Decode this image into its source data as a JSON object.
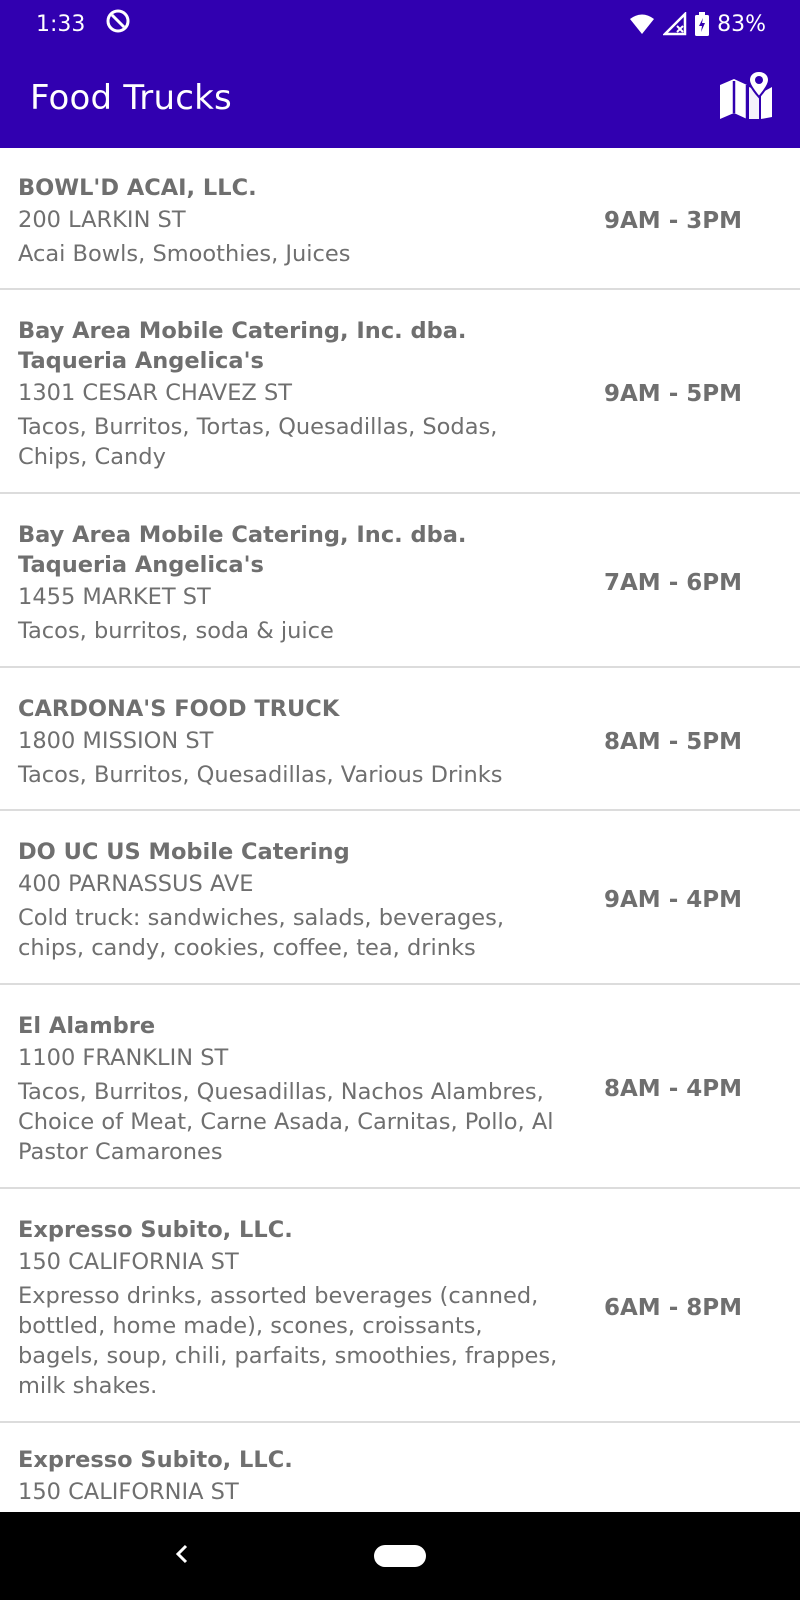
{
  "status_bar": {
    "time": "1:33",
    "battery": "83%",
    "icons": [
      "data-saver-icon",
      "wifi-icon",
      "signal-icon",
      "battery-icon"
    ]
  },
  "app_bar": {
    "title": "Food Trucks",
    "map_icon": "map-icon",
    "color": "#3100b0"
  },
  "trucks": [
    {
      "name": "BOWL'D ACAI, LLC.",
      "address": "200 LARKIN ST",
      "items": "Acai Bowls, Smoothies, Juices",
      "hours": "9AM - 3PM"
    },
    {
      "name": "Bay Area Mobile Catering, Inc. dba. Taqueria Angelica's",
      "address": "1301 CESAR CHAVEZ ST",
      "items": "Tacos, Burritos, Tortas, Quesadillas, Sodas, Chips, Candy",
      "hours": "9AM - 5PM"
    },
    {
      "name": "Bay Area Mobile Catering, Inc. dba. Taqueria Angelica's",
      "address": "1455 MARKET ST",
      "items": "Tacos, burritos, soda & juice",
      "hours": "7AM - 6PM"
    },
    {
      "name": "CARDONA'S FOOD TRUCK",
      "address": "1800 MISSION ST",
      "items": "Tacos, Burritos, Quesadillas, Various Drinks",
      "hours": "8AM - 5PM"
    },
    {
      "name": "DO UC US Mobile Catering",
      "address": "400 PARNASSUS AVE",
      "items": "Cold truck: sandwiches, salads, beverages, chips, candy, cookies, coffee, tea, drinks",
      "hours": "9AM - 4PM"
    },
    {
      "name": "El Alambre",
      "address": "1100 FRANKLIN ST",
      "items": "Tacos, Burritos, Quesadillas, Nachos Alambres, Choice of Meat, Carne Asada, Carnitas, Pollo, Al Pastor Camarones",
      "hours": "8AM - 4PM"
    },
    {
      "name": "Expresso Subito, LLC.",
      "address": "150 CALIFORNIA ST",
      "items": "Expresso drinks, assorted beverages (canned, bottled, home made), scones, croissants, bagels, soup, chili, parfaits, smoothies, frappes, milk shakes.",
      "hours": "6AM - 8PM"
    },
    {
      "name": "Expresso Subito, LLC.",
      "address": "150 CALIFORNIA ST",
      "items": "",
      "hours": ""
    }
  ],
  "nav_bar": {
    "icons": [
      "back-icon",
      "home-pill"
    ]
  }
}
